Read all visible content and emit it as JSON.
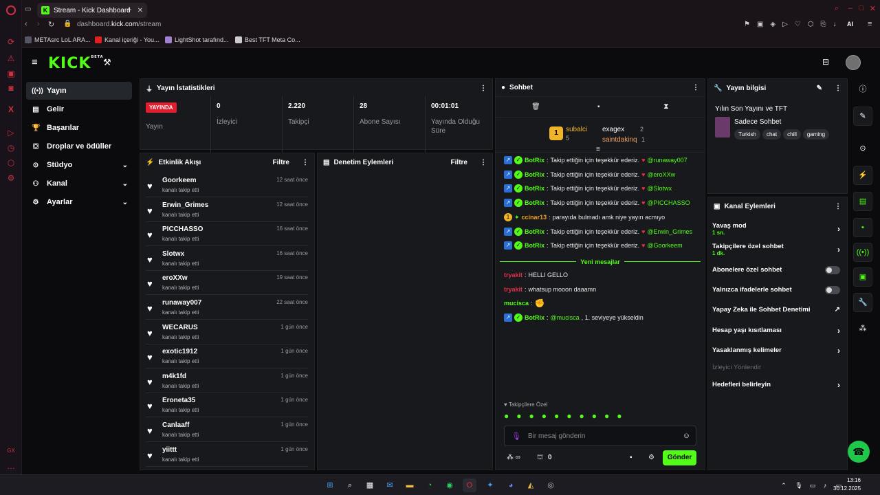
{
  "browser": {
    "tab_title": "Stream - Kick Dashboard",
    "tab_favicon": "K",
    "url_prefix": "dashboard.",
    "url_domain": "kick.com",
    "url_path": "/stream",
    "bookmarks": [
      "METAsrc LoL ARA...",
      "Kanal içeriği - You...",
      "LightShot tarafınd...",
      "Best TFT Meta Co..."
    ],
    "ai_label": "AI"
  },
  "app": {
    "logo": "KICK",
    "logo_badge": "BETA"
  },
  "nav": {
    "items": [
      {
        "label": "Yayın",
        "icon": "broadcast-icon"
      },
      {
        "label": "Gelir",
        "icon": "revenue-icon"
      },
      {
        "label": "Başarılar",
        "icon": "trophy-icon"
      },
      {
        "label": "Droplar ve ödüller",
        "icon": "gift-icon"
      },
      {
        "label": "Stüdyo",
        "icon": "studio-icon"
      },
      {
        "label": "Kanal",
        "icon": "channel-icon"
      },
      {
        "label": "Ayarlar",
        "icon": "gear-icon"
      }
    ]
  },
  "stats": {
    "title": "Yayın İstatistikleri",
    "live_badge": "YAYINDA",
    "items": [
      {
        "value": "",
        "label": "Yayın"
      },
      {
        "value": "0",
        "label": "İzleyici"
      },
      {
        "value": "2.220",
        "label": "Takipçi"
      },
      {
        "value": "28",
        "label": "Abone Sayısı"
      },
      {
        "value": "00:01:01",
        "label": "Yayında Olduğu Süre"
      }
    ]
  },
  "activity": {
    "title": "Etkinlik Akışı",
    "filter": "Filtre",
    "items": [
      {
        "name": "Goorkeem",
        "sub": "kanalı takip etti",
        "time": "12 saat önce"
      },
      {
        "name": "Erwin_Grimes",
        "sub": "kanalı takip etti",
        "time": "12 saat önce"
      },
      {
        "name": "PICCHASSO",
        "sub": "kanalı takip etti",
        "time": "16 saat önce"
      },
      {
        "name": "Slotwx",
        "sub": "kanalı takip etti",
        "time": "16 saat önce"
      },
      {
        "name": "eroXXw",
        "sub": "kanalı takip etti",
        "time": "19 saat önce"
      },
      {
        "name": "runaway007",
        "sub": "kanalı takip etti",
        "time": "22 saat önce"
      },
      {
        "name": "WECARUS",
        "sub": "kanalı takip etti",
        "time": "1 gün önce"
      },
      {
        "name": "exotic1912",
        "sub": "kanalı takip etti",
        "time": "1 gün önce"
      },
      {
        "name": "m4k1fd",
        "sub": "kanalı takip etti",
        "time": "1 gün önce"
      },
      {
        "name": "Eroneta35",
        "sub": "kanalı takip etti",
        "time": "1 gün önce"
      },
      {
        "name": "Canlaaff",
        "sub": "kanalı takip etti",
        "time": "1 gün önce"
      },
      {
        "name": "yiittt",
        "sub": "kanalı takip etti",
        "time": "1 gün önce"
      }
    ]
  },
  "moderation": {
    "title": "Denetim Eylemleri",
    "filter": "Filtre"
  },
  "chat": {
    "title": "Sohbet",
    "leaderboard": [
      {
        "name": "subalci",
        "count": "5"
      },
      {
        "name": "exagex",
        "count": "2"
      },
      {
        "name": "saintdakinq",
        "count": "1"
      }
    ],
    "messages": [
      {
        "user": "BotRix",
        "text": "Takip ettiğin için teşekkür ederiz.",
        "mention": "@runaway007"
      },
      {
        "user": "BotRix",
        "text": "Takip ettiğin için teşekkür ederiz.",
        "mention": "@eroXXw"
      },
      {
        "user": "BotRix",
        "text": "Takip ettiğin için teşekkür ederiz.",
        "mention": "@Slotwx"
      },
      {
        "user": "BotRix",
        "text": "Takip ettiğin için teşekkür ederiz.",
        "mention": "@PICCHASSO"
      },
      {
        "user": "ccinar13",
        "text": "parayıda bulmadı amk niye yayın acmıyo",
        "mention": ""
      },
      {
        "user": "BotRix",
        "text": "Takip ettiğin için teşekkür ederiz.",
        "mention": "@Erwin_Grimes"
      },
      {
        "user": "BotRix",
        "text": "Takip ettiğin için teşekkür ederiz.",
        "mention": "@Goorkeem"
      }
    ],
    "new_messages": "Yeni mesajlar",
    "new": [
      {
        "user": "tryakit",
        "text": "HELLI GELLO",
        "mention": "",
        "color": "#e0304a"
      },
      {
        "user": "tryakit",
        "text": "whatsup mooon daaamn",
        "mention": "",
        "color": "#e0304a"
      },
      {
        "user": "mucisca",
        "text": "",
        "mention": "",
        "color": "#53fc18"
      },
      {
        "user": "BotRix",
        "text": ", 1. seviyeye yükseldin",
        "mention": "@mucisca",
        "color": "#53fc18"
      }
    ],
    "followers_only": "Takipçilere Özel",
    "input_placeholder": "Bir mesaj gönderin",
    "viewer_count": "0",
    "send": "Gönder"
  },
  "stream_info": {
    "title": "Yayın bilgisi",
    "stream_title": "Yılın Son Yayını ve TFT",
    "category": "Sadece Sohbet",
    "tags": [
      "Turkish",
      "chat",
      "chill",
      "gaming"
    ]
  },
  "channel_actions": {
    "title": "Kanal Eylemleri",
    "items": [
      {
        "label": "Yavaş mod",
        "sub": "1 sn.",
        "control": "arrow"
      },
      {
        "label": "Takipçilere özel sohbet",
        "sub": "1 dk.",
        "control": "arrow"
      },
      {
        "label": "Abonelere özel sohbet",
        "sub": "",
        "control": "toggle"
      },
      {
        "label": "Yalnızca ifadelerle sohbet",
        "sub": "",
        "control": "toggle"
      },
      {
        "label": "Yapay Zeka ile Sohbet Denetimi",
        "sub": "",
        "control": "external"
      },
      {
        "label": "Hesap yaşı kısıtlaması",
        "sub": "",
        "control": "arrow"
      },
      {
        "label": "Yasaklanmış kelimeler",
        "sub": "",
        "control": "arrow"
      },
      {
        "label": "İzleyici Yönlendir",
        "sub": "",
        "control": "disabled"
      },
      {
        "label": "Hedefleri belirleyin",
        "sub": "",
        "control": "arrow"
      }
    ]
  },
  "taskbar": {
    "time": "13:16",
    "date": "30.12.2025"
  }
}
